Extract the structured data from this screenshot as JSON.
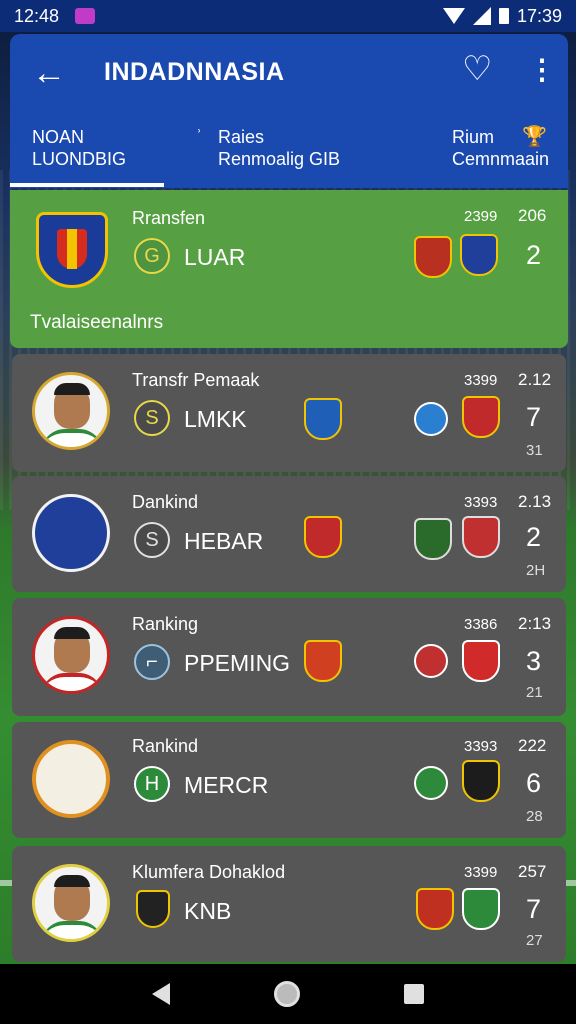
{
  "status_bar": {
    "time_left": "12:48",
    "time_right": "17:39"
  },
  "header": {
    "title": "INDADNNASIA",
    "tabs": [
      {
        "line1": "NOAN",
        "line2": "LUONDBIG"
      },
      {
        "mark": "ʾ",
        "line1": "Raies",
        "line2": "Renmoalig GIB"
      },
      {
        "line1": "Rium",
        "line2": "Cemnmaain"
      }
    ]
  },
  "featured": {
    "label": "Rransfen",
    "name": "LUAR",
    "icon_glyph": "G",
    "num1": "2399",
    "num2": "206",
    "score": "2",
    "footer": "Tvalaiseenalnrs"
  },
  "cards": [
    {
      "label": "Transfr Pemaak",
      "name": "LMKK",
      "icon_glyph": "S",
      "num1": "3399",
      "num2": "2.12",
      "score": "7",
      "sub": "31"
    },
    {
      "label": "Dankind",
      "name": "HEBAR",
      "icon_glyph": "S",
      "num1": "3393",
      "num2": "2.13",
      "score": "2",
      "sub": "2H"
    },
    {
      "label": "Ranking",
      "name": "PPEMING",
      "icon_glyph": "⌐",
      "num1": "3386",
      "num2": "2:13",
      "score": "3",
      "sub": "21"
    },
    {
      "label": "Rankind",
      "name": "MERCR",
      "icon_glyph": "H",
      "num1": "3393",
      "num2": "222",
      "score": "6",
      "sub": "28"
    },
    {
      "label": "Klumfera Dohaklod",
      "name": "KNB",
      "icon_glyph": "",
      "num1": "3399",
      "num2": "257",
      "score": "7",
      "sub": "27"
    }
  ],
  "icons": [
    "back-arrow-icon",
    "heart-icon",
    "more-vert-icon"
  ]
}
